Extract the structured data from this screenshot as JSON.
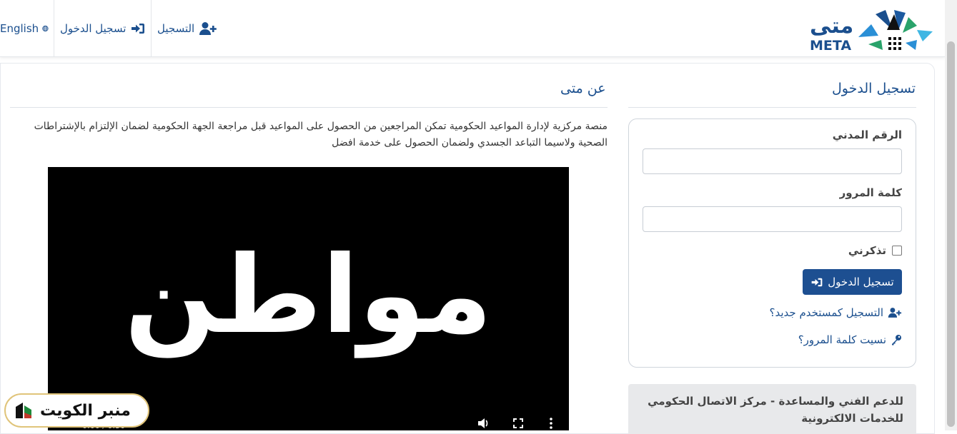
{
  "nav": {
    "register": "التسجيل",
    "login": "تسجيل الدخول",
    "language": "English"
  },
  "logo": {
    "arabic": "متى",
    "latin": "META"
  },
  "about": {
    "title": "عن متى",
    "text": "منصة مركزية لإدارة المواعيد الحكومية تمكن المراجعين من الحصول على المواعيد قبل مراجعة الجهة الحكومية لضمان الإلتزام بالإشتراطات الصحية ولاسيما التباعد الجسدي ولضمان الحصول على خدمة افضل"
  },
  "video": {
    "word": "مواطن",
    "time": "0:00 / 0:30"
  },
  "login": {
    "title": "تسجيل الدخول",
    "civil_id_label": "الرقم المدني",
    "password_label": "كلمة المرور",
    "remember_label": "تذكرني",
    "submit_label": "تسجيل الدخول",
    "register_link": "التسجيل كمستخدم جديد؟",
    "forgot_link": "نسيت كلمة المرور؟"
  },
  "support": {
    "text": "للدعم الفني والمساعدة - مركز الاتصال الحكومي للخدمات الالكترونية"
  },
  "watermark": {
    "text": "منبر الكويت"
  },
  "colors": {
    "brand": "#1b4f8e",
    "button": "#1d4f91"
  }
}
